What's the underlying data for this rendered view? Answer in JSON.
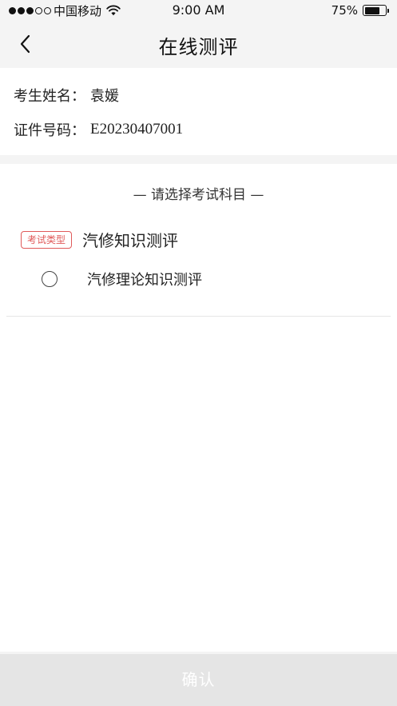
{
  "status_bar": {
    "carrier": "中国移动",
    "time": "9:00 AM",
    "battery_text": "75%",
    "battery_level": 0.75,
    "signal_bars_filled": 3,
    "signal_bars_total": 5,
    "icons": [
      "wifi-icon",
      "battery-icon"
    ]
  },
  "nav": {
    "title": "在线测评",
    "back_icon": "chevron-left-icon"
  },
  "candidate": {
    "name_label": "考生姓名：",
    "name_value": "袁媛",
    "id_label": "证件号码：",
    "id_value": "E20230407001"
  },
  "subjects": {
    "heading": "— 请选择考试科目 —",
    "type_badge": "考试类型",
    "type_name": "汽修知识测评",
    "options": [
      {
        "label": "汽修理论知识测评",
        "selected": false
      }
    ]
  },
  "footer": {
    "confirm_label": "确认"
  },
  "colors": {
    "background": "#f4f4f4",
    "card": "#ffffff",
    "badge_red": "#e05a5a",
    "confirm_disabled_bg": "#e5e5e5",
    "confirm_text": "#ffffff"
  }
}
